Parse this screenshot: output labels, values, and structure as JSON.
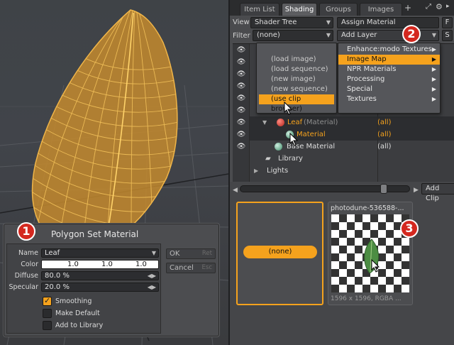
{
  "tabs": {
    "item_list": "Item List",
    "shading": "Shading",
    "groups": "Groups",
    "images": "Images",
    "add": "+"
  },
  "toolbar": {
    "view_label": "View",
    "view_value": "Shader Tree",
    "assign_material": "Assign Material",
    "f_button": "F",
    "filter_label": "Filter",
    "filter_value": "(none)",
    "add_layer": "Add Layer",
    "s_button": "S"
  },
  "clip_submenu": {
    "items": [
      "(load image)",
      "(load sequence)",
      "(new image)",
      "(new sequence)",
      "(use clip browser)"
    ]
  },
  "add_layer_menu": {
    "items": [
      "Enhance:modo Textures",
      "Image Map",
      "NPR Materials",
      "Processing",
      "Special",
      "Textures"
    ]
  },
  "shader_tree": {
    "leaf_name": "Leaf",
    "leaf_type": "(Material)",
    "leaf_value": "(all)",
    "material_name": "Material",
    "material_value": "(all)",
    "base_material_name": "Base Material",
    "base_material_value": "(all)",
    "library": "Library",
    "lights": "Lights"
  },
  "clip_browser": {
    "add_clip": "Add Clip",
    "none_label": "(none)",
    "thumb_name": "photodune-536588-...",
    "thumb_info": "1596 x 1596, RGBA ..."
  },
  "polygon_set_material": {
    "title": "Polygon Set Material",
    "name_label": "Name",
    "name_value": "Leaf",
    "color_label": "Color",
    "color_r": "1.0",
    "color_g": "1.0",
    "color_b": "1.0",
    "diffuse_label": "Diffuse",
    "diffuse_value": "80.0 %",
    "specular_label": "Specular",
    "specular_value": "20.0 %",
    "smoothing": "Smoothing",
    "make_default": "Make Default",
    "add_to_library": "Add to Library",
    "ok": "OK",
    "ok_key": "Ret",
    "cancel": "Cancel",
    "cancel_key": "Esc"
  },
  "badges": {
    "one": "1",
    "two": "2",
    "three": "3"
  },
  "colors": {
    "accent": "#f5a21d",
    "badge": "#d4281f",
    "mesh": "#e0a640"
  }
}
